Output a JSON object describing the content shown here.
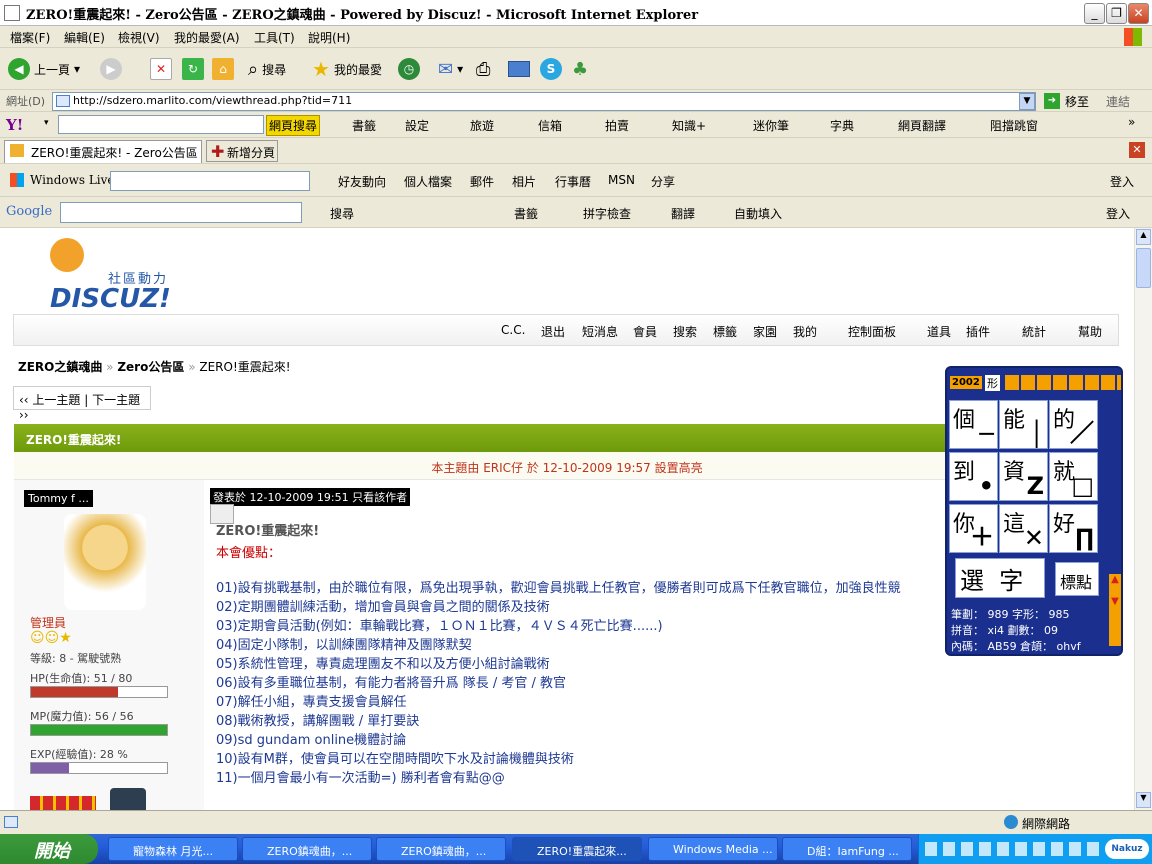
{
  "window": {
    "title": "ZERO!重震起來! - Zero公告區 - ZERO之鎮魂曲 - Powered by Discuz! - Microsoft Internet Explorer"
  },
  "menu": [
    "檔案(F)",
    "編輯(E)",
    "檢視(V)",
    "我的最愛(A)",
    "工具(T)",
    "說明(H)"
  ],
  "toolbar": {
    "back": "上一頁",
    "search": "搜尋",
    "favorites": "我的最愛"
  },
  "address": {
    "label": "網址(D)",
    "url": "http://sdzero.marlito.com/viewthread.php?tid=711",
    "go": "移至",
    "links": "連結"
  },
  "yahoo": {
    "search_btn": "網頁搜尋",
    "items": [
      "書籤",
      "設定",
      "旅遊",
      "信箱",
      "拍賣",
      "知識+",
      "迷你筆",
      "字典",
      "網頁翻譯",
      "阻擋跳窗"
    ]
  },
  "tabs": {
    "current": "ZERO!重震起來! - Zero公告區 ...",
    "new": "新增分頁"
  },
  "live": {
    "label": "Windows Live",
    "items": [
      "好友動向",
      "個人檔案",
      "郵件",
      "相片",
      "行事曆",
      "MSN",
      "分享"
    ],
    "login": "登入"
  },
  "google": {
    "label": "Google",
    "search": "搜尋",
    "bookmarks": "書籤",
    "spell": "拼字檢查",
    "translate": "翻譯",
    "autofill": "自動填入",
    "login": "登入"
  },
  "forum": {
    "logo_sub": "社區動力",
    "logo": "DISCUZ!",
    "nav": [
      "C.C.",
      "退出",
      "短消息",
      "會員",
      "搜索",
      "標籤",
      "家園",
      "我的",
      "控制面板",
      "道具",
      "插件",
      "統計",
      "幫助"
    ],
    "breadcrumb": [
      "ZERO之鎮魂曲",
      "»",
      "Zero公告區",
      "»",
      "ZERO!重震起來!"
    ],
    "prevnext": "‹‹ 上一主題 | 下一主題 ››",
    "thread_title": "ZERO!重震起來!",
    "highlight": "本主題由 ERIC仔 於 12-10-2009 19:57 設置高亮",
    "author": "Tommy f ...",
    "posted": "發表於 12-10-2009 19:51  只看該作者",
    "post_title": "ZERO!重震起來!",
    "intro": "本會優點：",
    "lines": [
      "01)設有挑戰基制，由於職位有限，爲免出現爭執，歡迎會員挑戰上任教官，優勝者則可成爲下任教官職位，加強良性競",
      "02)定期團體訓練活動，增加會員與會員之間的關係及技術",
      "03)定期會員活動(例如：車輪戰比賽，１ＯＮ１比賽，４ＶＳ４死亡比賽......)",
      "04)固定小隊制，以訓練團隊精神及團隊默契",
      "05)系統性管理，專責處理團友不和以及方便小組討論戰術",
      "06)設有多重職位基制，有能力者將晉升爲 隊長 / 考官 / 教官",
      "07)解任小組，專責支援會員解任",
      "08)戰術教授，講解團戰 / 單打要訣",
      "09)sd gundam online機體討論",
      "10)設有M群，使會員可以在空閒時間吹下水及討論機體與技術",
      "11)一個月會最小有一次活動=) 勝利者會有點@@"
    ],
    "role": "管理員",
    "level": "等級: 8 - 駕駛號熟",
    "hp": {
      "label": "HP(生命值): 51 / 80",
      "fraction": 0.64
    },
    "mp": {
      "label": "MP(魔力值): 56 / 56",
      "fraction": 1.0
    },
    "exp": {
      "label": "EXP(經驗值): 28 %",
      "fraction": 0.28
    }
  },
  "ime": {
    "year": "2002",
    "shape": "形",
    "cells": [
      {
        "k": "個",
        "m": "─"
      },
      {
        "k": "能",
        "m": "│"
      },
      {
        "k": "的",
        "m": "／"
      },
      {
        "k": "到",
        "m": "•"
      },
      {
        "k": "資",
        "m": "Z"
      },
      {
        "k": "就",
        "m": "□"
      },
      {
        "k": "你",
        "m": "＋"
      },
      {
        "k": "這",
        "m": "✕"
      },
      {
        "k": "好",
        "m": "∏"
      }
    ],
    "select": "選  字",
    "punct": "標點",
    "info1": "筆劃： 989 字形： 985",
    "info2": "拼音： xi4 劃數： 09",
    "info3": "內碼： AB59 倉頡： ohvf"
  },
  "status": {
    "zone": "網際網路"
  },
  "taskbar": {
    "start": "開始",
    "tasks": [
      "寵物森林 月光...",
      "ZERO鎮魂曲，...",
      "ZERO鎮魂曲，...",
      "ZERO!重震起來...",
      "Windows Media ...",
      "D組：IamFung ..."
    ]
  }
}
